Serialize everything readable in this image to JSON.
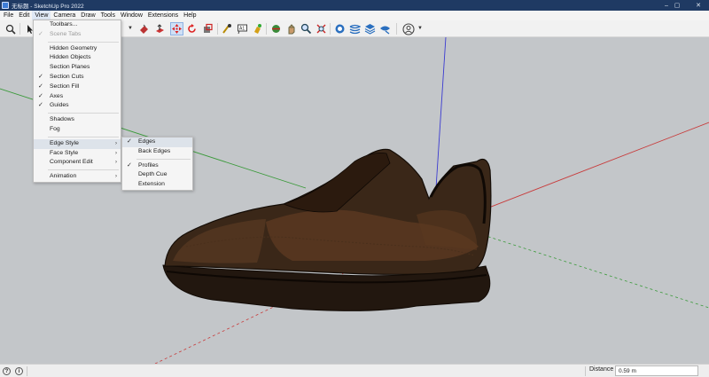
{
  "window": {
    "title": "无标题 - SketchUp Pro 2022",
    "controls": {
      "minimize": "–",
      "maximize": "▢",
      "close": "✕"
    }
  },
  "menubar": [
    "File",
    "Edit",
    "View",
    "Camera",
    "Draw",
    "Tools",
    "Window",
    "Extensions",
    "Help"
  ],
  "view_menu": {
    "items": [
      {
        "label": "Toolbars...",
        "checked": false,
        "disabled": false
      },
      {
        "label": "Scene Tabs",
        "checked": true,
        "disabled": true
      },
      {
        "separator": true
      },
      {
        "label": "Hidden Geometry",
        "checked": false
      },
      {
        "label": "Hidden Objects",
        "checked": false
      },
      {
        "label": "Section Planes",
        "checked": false
      },
      {
        "label": "Section Cuts",
        "checked": true
      },
      {
        "label": "Section Fill",
        "checked": true
      },
      {
        "label": "Axes",
        "checked": true
      },
      {
        "label": "Guides",
        "checked": true
      },
      {
        "separator": true
      },
      {
        "label": "Shadows",
        "checked": false
      },
      {
        "label": "Fog",
        "checked": false
      },
      {
        "separator": true
      },
      {
        "label": "Edge Style",
        "submenu": true,
        "highlighted": true
      },
      {
        "label": "Face Style",
        "submenu": true
      },
      {
        "label": "Component Edit",
        "submenu": true
      },
      {
        "separator": true
      },
      {
        "label": "Animation",
        "submenu": true
      }
    ]
  },
  "edge_style_menu": {
    "items": [
      {
        "label": "Edges",
        "checked": true,
        "highlighted": true
      },
      {
        "label": "Back Edges",
        "checked": false
      },
      {
        "separator": true
      },
      {
        "label": "Profiles",
        "checked": true
      },
      {
        "label": "Depth Cue",
        "checked": false
      },
      {
        "label": "Extension",
        "checked": false
      }
    ]
  },
  "toolbar": {
    "icons": [
      "zoom-icon",
      "select-arrow-icon",
      "dropdown-caret-icon",
      "paint-bucket-icon",
      "push-pull-icon",
      "move-icon",
      "rotate-icon",
      "scale-icon",
      "tape-measure-icon",
      "text-icon",
      "paint-icon",
      "orbit-icon",
      "pan-icon",
      "zoom-tool-icon",
      "zoom-extents-icon",
      "warehouse-icon",
      "layers-icon",
      "stack-icon",
      "ext-warehouse-icon",
      "account-icon",
      "account-caret-icon"
    ]
  },
  "colors": {
    "viewport_bg": "#c3c6c9",
    "axis_red": "#c83b3b",
    "axis_green": "#3a9a3a",
    "axis_blue": "#3b3bd1",
    "shoe_dark": "#2a1c12",
    "shoe_brown": "#6b4226"
  },
  "statusbar": {
    "help_icon": "?",
    "info_icon": "i",
    "distance_label": "Distance",
    "distance_value": "0.59 m"
  }
}
